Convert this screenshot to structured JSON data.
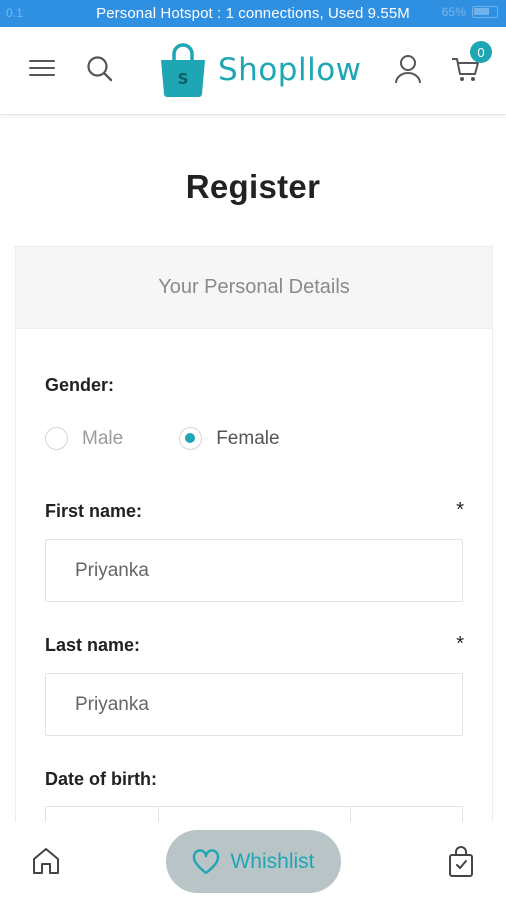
{
  "status_bar": {
    "text": "Personal Hotspot : 1 connections, Used 9.55M",
    "left_faint": "0.1",
    "battery_percent": "65%"
  },
  "header": {
    "brand": "Shopllow",
    "cart_count": "0",
    "icons": [
      "menu-icon",
      "search-icon",
      "user-icon",
      "cart-icon"
    ],
    "accent_color": "#1fa6b4"
  },
  "page": {
    "title": "Register"
  },
  "form": {
    "section_title": "Your Personal Details",
    "gender": {
      "label": "Gender:",
      "options": [
        {
          "label": "Male",
          "checked": false
        },
        {
          "label": "Female",
          "checked": true
        }
      ]
    },
    "first_name": {
      "label": "First name:",
      "required_mark": "*",
      "value": "Priyanka"
    },
    "last_name": {
      "label": "Last name:",
      "required_mark": "*",
      "value": "Priyanka"
    },
    "date_of_birth": {
      "label": "Date of birth:"
    }
  },
  "bottom_nav": {
    "wishlist_label": "Whishlist",
    "icons": [
      "home-icon",
      "heart-icon",
      "shopping-bag-icon"
    ]
  }
}
